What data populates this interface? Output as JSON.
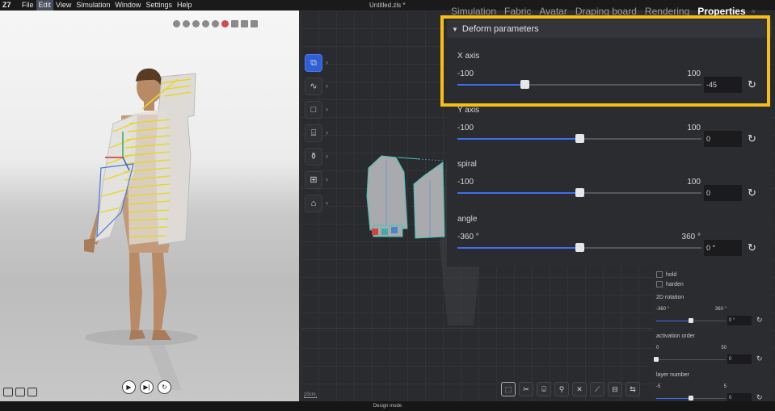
{
  "menubar": {
    "logo": "Z7",
    "items": [
      "File",
      "Edit",
      "View",
      "Simulation",
      "Window",
      "Settings",
      "Help"
    ],
    "active_item": "Edit",
    "document_title": "Untitled.zls *"
  },
  "tabs": {
    "items": [
      "Simulation",
      "Fabric",
      "Avatar",
      "Draping board",
      "Rendering",
      "Properties"
    ],
    "active": "Properties",
    "close_glyph": "×"
  },
  "deform_panel": {
    "title": "Deform parameters",
    "params": [
      {
        "name": "X axis",
        "min_label": "-100",
        "max_label": "100",
        "min": -100,
        "max": 100,
        "value": -45,
        "value_text": "-45"
      },
      {
        "name": "Y axis",
        "min_label": "-100",
        "max_label": "100",
        "min": -100,
        "max": 100,
        "value": 0,
        "value_text": "0"
      },
      {
        "name": "spiral",
        "min_label": "-100",
        "max_label": "100",
        "min": -100,
        "max": 100,
        "value": 0,
        "value_text": "0"
      },
      {
        "name": "angle",
        "min_label": "-360 °",
        "max_label": "360 °",
        "min": -360,
        "max": 360,
        "value": 0,
        "value_text": "0 °"
      }
    ]
  },
  "right_panel": {
    "checkboxes": [
      "hold",
      "harden"
    ],
    "params": [
      {
        "name": "2D rotation",
        "min_label": "-360 °",
        "max_label": "360 °",
        "min": -360,
        "max": 360,
        "value": 0,
        "value_text": "0 °"
      },
      {
        "name": "activation order",
        "min_label": "0",
        "max_label": "50",
        "min": 0,
        "max": 50,
        "value": 0,
        "value_text": "0"
      },
      {
        "name": "layer number",
        "min_label": "-5",
        "max_label": "5",
        "min": -5,
        "max": 5,
        "value": 0,
        "value_text": "0"
      }
    ]
  },
  "left_toolbar": {
    "icons": [
      "select-transform-icon",
      "curve-icon",
      "rectangle-icon",
      "sewing-icon",
      "bottle-icon",
      "map-icon",
      "sewing-machine-icon"
    ],
    "active_index": 0,
    "arrow_glyph": "›"
  },
  "bottom_toolbar": {
    "icons": [
      "transform-pattern-icon",
      "cut-icon",
      "seam-icon",
      "pin-icon",
      "scissor-icon",
      "knife-icon",
      "stitch-icon",
      "tape-icon"
    ],
    "active_index": 0
  },
  "playback": {
    "play_glyph": "▶",
    "step_glyph": "▶|",
    "reset_glyph": "↻"
  },
  "reset_glyph": "↻",
  "scale_label": "10cm",
  "status_text": "Design mode",
  "colors": {
    "accent": "#3f6ff0",
    "highlight": "#f7be16",
    "panel_bg": "#2b2c2f",
    "active_tool": "#2f5fd8"
  }
}
